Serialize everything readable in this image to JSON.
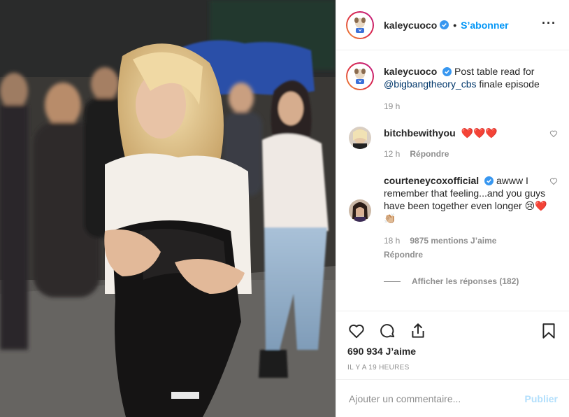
{
  "post": {
    "image_alt": "Photo of a woman hugging a jacket at a table read",
    "author": "kaleycuoco",
    "verified": true,
    "follow_label": "S’abonner",
    "more_icon": "more-options-icon"
  },
  "caption": {
    "author": "kaleycuoco",
    "text_1": "Post table read for",
    "mention": "@bigbangtheory_cbs",
    "text_2": "finale episode",
    "time": "19 h"
  },
  "comments": [
    {
      "author": "bitchbewithyou",
      "text": "❤️❤️❤️",
      "time": "12 h",
      "reply_label": "Répondre"
    },
    {
      "author": "courteneycoxofficial",
      "verified": true,
      "text": "awww I remember that feeling...and you guys have been together even longer 😢❤️👏🏼",
      "time": "18 h",
      "likes": "9875 mentions J’aime",
      "reply_label": "Répondre",
      "view_replies": "Afficher les réponses (182)"
    }
  ],
  "likes": "690 934 J’aime",
  "timestamp": "IL Y A 19 HEURES",
  "add_comment": {
    "placeholder": "Ajouter un commentaire...",
    "publish_label": "Publier"
  },
  "colors": {
    "accent": "#0095f6",
    "publish_disabled": "#b2dffc",
    "heart_red": "#ed4956",
    "muted": "#8e8e8e"
  }
}
